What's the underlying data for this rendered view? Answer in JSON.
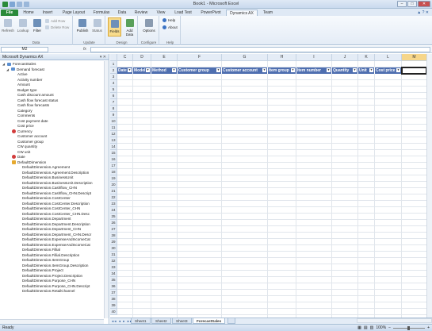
{
  "window": {
    "title": "Book1 - Microsoft Excel"
  },
  "tabs": [
    "File",
    "Home",
    "Insert",
    "Page Layout",
    "Formulas",
    "Data",
    "Review",
    "View",
    "Load Test",
    "PowerPivot",
    "Dynamics AX",
    "Team"
  ],
  "active_tab": "Dynamics AX",
  "ribbon": {
    "data_group": {
      "label": "Data",
      "refresh": "Refresh",
      "lookup": "Lookup",
      "filter": "Filter",
      "add_row": "Add Row",
      "delete_row": "Delete Row"
    },
    "update_group": {
      "label": "Update",
      "publish": "Publish",
      "status": "Status"
    },
    "design_group": {
      "label": "Design",
      "fields": "Fields",
      "add_data": "Add Data"
    },
    "configure_group": {
      "label": "Configure",
      "options": "Options"
    },
    "help_group": {
      "label": "Help",
      "help": "Help",
      "about": "About"
    }
  },
  "formula_bar": {
    "name_box": "M2",
    "fx": "fx",
    "value": ""
  },
  "pane": {
    "title": "Microsoft Dynamics AX",
    "root": "ForecastSales",
    "table": "Demand forecast",
    "fields": [
      "Active",
      "Activity number",
      "Amount",
      "Budget type",
      "Cash discount amount",
      "Cash flow forecast status",
      "Cash flow forecasts",
      "Category",
      "Comments",
      "Cost payment date",
      "Cost price",
      "Currency",
      "Customer account",
      "Customer group",
      "CW quantity",
      "CW unit",
      "Date",
      "DefaultDimension"
    ],
    "dimensions": [
      "DefaultDimension.Agreement",
      "DefaultDimension.Agreement.Description",
      "DefaultDimension.BusinessUnit",
      "DefaultDimension.BusinessUnit.Description",
      "DefaultDimension.Cashflow_CHN",
      "DefaultDimension.Cashflow_CHN.Descript",
      "DefaultDimension.CostCenter",
      "DefaultDimension.CostCenter.Description",
      "DefaultDimension.CostCenter_CHN",
      "DefaultDimension.CostCenter_CHN.Desc",
      "DefaultDimension.Department",
      "DefaultDimension.Department.Description",
      "DefaultDimension.Department_CHN",
      "DefaultDimension.Department_CHN.Descr",
      "DefaultDimension.ExpenseAndIncomeCat",
      "DefaultDimension.ExpenseAndIncomeCat",
      "DefaultDimension.Fillial",
      "DefaultDimension.Fillial.Description",
      "DefaultDimension.ItemGroup",
      "DefaultDimension.ItemGroup.Description",
      "DefaultDimension.Project",
      "DefaultDimension.Project.Description",
      "DefaultDimension.Purpose_CHN",
      "DefaultDimension.Purpose_CHN.Descript",
      "DefaultDimension.RetailChannel"
    ]
  },
  "grid": {
    "columns": [
      "C",
      "D",
      "E",
      "F",
      "G",
      "H",
      "I",
      "J",
      "K",
      "L",
      "M"
    ],
    "selected_column": "M",
    "rows": [
      "1",
      "2",
      "3",
      "4",
      "5",
      "6",
      "7",
      "8",
      "9",
      "10",
      "11",
      "12",
      "13",
      "14",
      "15",
      "16",
      "17",
      "18",
      "19",
      "20",
      "21",
      "22",
      "23",
      "24",
      "25",
      "26",
      "27",
      "28",
      "29",
      "30",
      "31",
      "32",
      "33",
      "34",
      "35",
      "36",
      "37",
      "38",
      "39",
      "40"
    ],
    "headers": [
      "Date",
      "Model",
      "Method",
      "Customer group",
      "Customer account",
      "Item group",
      "Item number",
      "Quantity",
      "Unit",
      "Cost price"
    ]
  },
  "sheets": [
    "Sheet1",
    "Sheet2",
    "Sheet3",
    "ForecastSales"
  ],
  "active_sheet": "ForecastSales",
  "status": {
    "ready": "Ready",
    "zoom": "100%"
  }
}
